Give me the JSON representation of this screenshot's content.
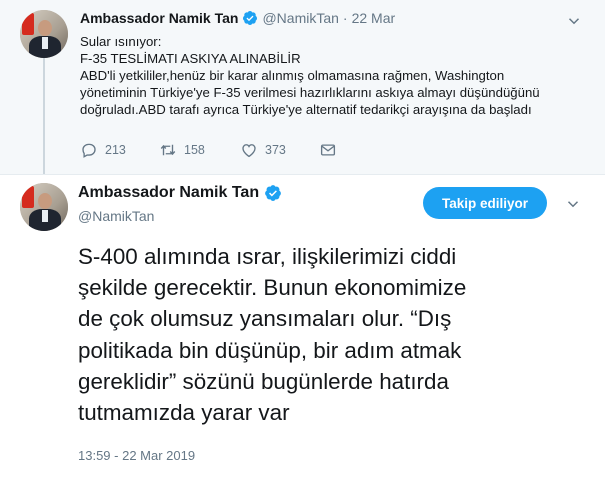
{
  "parent_tweet": {
    "author_name": "Ambassador Namik Tan",
    "handle": "@NamikTan",
    "separator": "·",
    "date": "22 Mar",
    "text_lines": [
      "Sular ısınıyor:",
      "F-35 TESLİMATI ASKIYA ALINABİLİR",
      "ABD'li yetkililer,henüz bir karar alınmış olmamasına rağmen, Washington",
      "yönetiminin Türkiye'ye F-35 verilmesi hazırlıklarını askıya almayı düşündüğünü",
      "doğruladı.ABD tarafı ayrıca Türkiye'ye alternatif tedarikçi arayışına da başladı"
    ],
    "actions": {
      "reply_count": "213",
      "retweet_count": "158",
      "like_count": "373"
    }
  },
  "main_tweet": {
    "author_name": "Ambassador Namik Tan",
    "handle": "@NamikTan",
    "follow_button_label": "Takip ediliyor",
    "text_lines": [
      "S-400 alımında ısrar, ilişkilerimizi ciddi",
      "şekilde gerecektir. Bunun ekonomimize",
      "de çok olumsuz yansımaları olur. “Dış",
      "politikada bin düşünüp, bir adım atmak",
      "gereklidir” sözünü bugünlerde hatırda",
      "tutmamızda yarar var"
    ],
    "timestamp": "13:59 - 22 Mar 2019"
  },
  "icons": {
    "verified": "verified-badge-icon",
    "reply": "reply-icon",
    "retweet": "retweet-icon",
    "like": "heart-icon",
    "message": "envelope-icon",
    "more": "chevron-down-icon"
  },
  "colors": {
    "brand_blue": "#1da1f2",
    "secondary_text": "#657786",
    "primary_text": "#14171a",
    "parent_background": "#f5f8fa"
  }
}
